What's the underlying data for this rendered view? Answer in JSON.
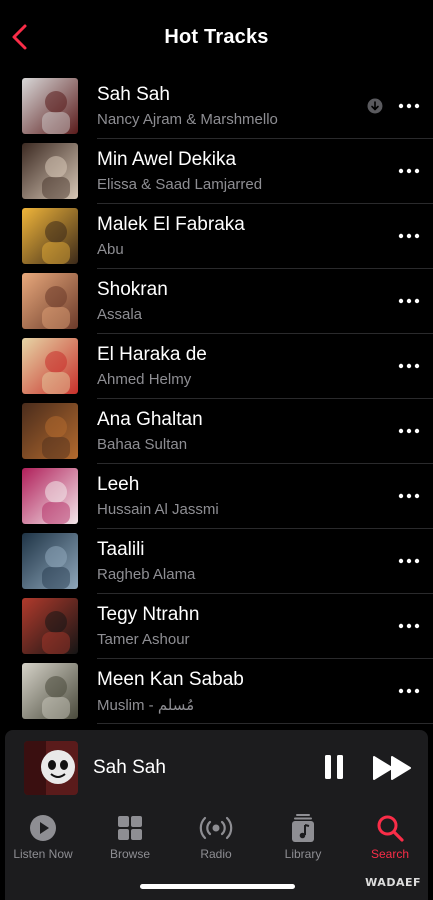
{
  "nav": {
    "title": "Hot Tracks",
    "back_icon": "chevron-left-icon"
  },
  "colors": {
    "accent": "#fa2d48",
    "background": "#000000",
    "secondary_text": "#8e8e93",
    "player_bg": "#1c1c1e"
  },
  "tracks": [
    {
      "title": "Sah Sah",
      "artist": "Nancy Ajram & Marshmello",
      "art": [
        "#d8d8d8",
        "#5a1b1b"
      ],
      "downloaded": true
    },
    {
      "title": "Min Awel Dekika",
      "artist": "Elissa & Saad Lamjarred",
      "art": [
        "#3c2a22",
        "#d7c7b6"
      ]
    },
    {
      "title": "Malek El Fabraka",
      "artist": "Abu",
      "art": [
        "#f0b53a",
        "#3c2a1a"
      ]
    },
    {
      "title": "Shokran",
      "artist": "Assala",
      "art": [
        "#e8a97c",
        "#6b3a2a"
      ]
    },
    {
      "title": "El Haraka de",
      "artist": "Ahmed Helmy",
      "art": [
        "#e6d5a6",
        "#c8302b"
      ]
    },
    {
      "title": "Ana Ghaltan",
      "artist": "Bahaa Sultan",
      "art": [
        "#4a2c1c",
        "#b36a2e"
      ]
    },
    {
      "title": "Leeh",
      "artist": "Hussain Al Jassmi",
      "art": [
        "#b01f5a",
        "#f3e7ea"
      ]
    },
    {
      "title": "Taalili",
      "artist": "Ragheb Alama",
      "art": [
        "#1f3446",
        "#8fa7bb"
      ]
    },
    {
      "title": "Tegy Ntrahn",
      "artist": "Tamer Ashour",
      "art": [
        "#b13a2c",
        "#151515"
      ]
    },
    {
      "title": "Meen Kan Sabab",
      "artist": "Muslim - مُسلم",
      "art": [
        "#d5d2c8",
        "#4a4a3c"
      ]
    }
  ],
  "player": {
    "title": "Sah Sah",
    "pause_icon": "pause-icon",
    "next_icon": "forward-icon"
  },
  "tabs": [
    {
      "label": "Listen Now",
      "icon": "play-circle-icon"
    },
    {
      "label": "Browse",
      "icon": "grid-icon"
    },
    {
      "label": "Radio",
      "icon": "radio-icon"
    },
    {
      "label": "Library",
      "icon": "library-icon"
    },
    {
      "label": "Search",
      "icon": "search-icon",
      "active": true
    }
  ],
  "watermark": "WADAEF"
}
